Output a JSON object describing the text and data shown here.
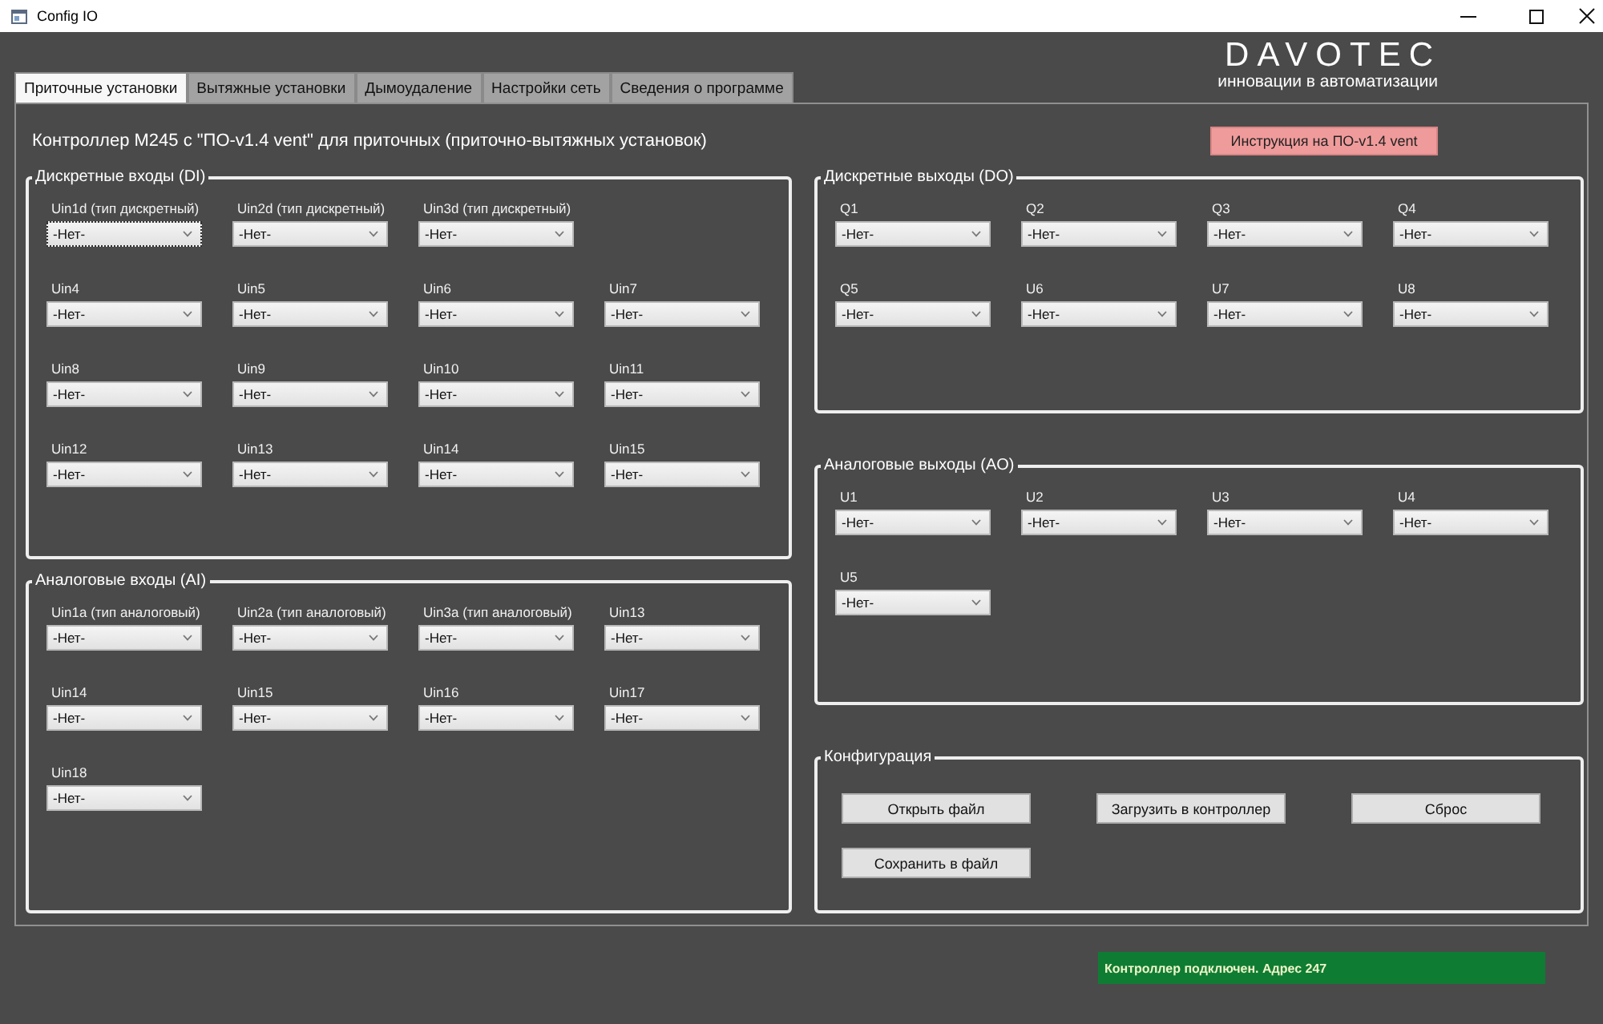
{
  "window": {
    "title": "Config IO"
  },
  "logo": {
    "brand": "DAVOTEC",
    "tagline": "инновации в автоматизации"
  },
  "tabs": [
    {
      "label": "Приточные установки",
      "selected": true
    },
    {
      "label": "Вытяжные установки",
      "selected": false
    },
    {
      "label": "Дымоудаление",
      "selected": false
    },
    {
      "label": "Настройки сеть",
      "selected": false
    },
    {
      "label": "Сведения о программе",
      "selected": false
    }
  ],
  "header": {
    "title": "Контроллер M245 с \"ПО-v1.4 vent\" для приточных (приточно-вытяжных установок)",
    "manual_button": "Инструкция на ПО-v1.4 vent"
  },
  "left_groups": [
    {
      "kind": "selects",
      "title": "Дискретные входы (DI)",
      "rows": [
        [
          {
            "label": "Uin1d (тип дискретный)",
            "value": "-Нет-",
            "focused": true
          },
          {
            "label": "Uin2d (тип дискретный)",
            "value": "-Нет-",
            "focused": false
          },
          {
            "label": "Uin3d (тип дискретный)",
            "value": "-Нет-",
            "focused": false
          }
        ],
        [
          {
            "label": "Uin4",
            "value": "-Нет-",
            "focused": false
          },
          {
            "label": "Uin5",
            "value": "-Нет-",
            "focused": false
          },
          {
            "label": "Uin6",
            "value": "-Нет-",
            "focused": false
          },
          {
            "label": "Uin7",
            "value": "-Нет-",
            "focused": false
          }
        ],
        [
          {
            "label": "Uin8",
            "value": "-Нет-",
            "focused": false
          },
          {
            "label": "Uin9",
            "value": "-Нет-",
            "focused": false
          },
          {
            "label": "Uin10",
            "value": "-Нет-",
            "focused": false
          },
          {
            "label": "Uin11",
            "value": "-Нет-",
            "focused": false
          }
        ],
        [
          {
            "label": "Uin12",
            "value": "-Нет-",
            "focused": false
          },
          {
            "label": "Uin13",
            "value": "-Нет-",
            "focused": false
          },
          {
            "label": "Uin14",
            "value": "-Нет-",
            "focused": false
          },
          {
            "label": "Uin15",
            "value": "-Нет-",
            "focused": false
          }
        ]
      ]
    },
    {
      "kind": "selects",
      "title": "Аналоговые входы (AI)",
      "rows": [
        [
          {
            "label": "Uin1a (тип аналоговый)",
            "value": "-Нет-",
            "focused": false
          },
          {
            "label": "Uin2a (тип аналоговый)",
            "value": "-Нет-",
            "focused": false
          },
          {
            "label": "Uin3a (тип аналоговый)",
            "value": "-Нет-",
            "focused": false
          },
          {
            "label": "Uin13",
            "value": "-Нет-",
            "focused": false
          }
        ],
        [
          {
            "label": "Uin14",
            "value": "-Нет-",
            "focused": false
          },
          {
            "label": "Uin15",
            "value": "-Нет-",
            "focused": false
          },
          {
            "label": "Uin16",
            "value": "-Нет-",
            "focused": false
          },
          {
            "label": "Uin17",
            "value": "-Нет-",
            "focused": false
          }
        ],
        [
          {
            "label": "Uin18",
            "value": "-Нет-",
            "focused": false
          }
        ]
      ]
    }
  ],
  "right_groups": [
    {
      "kind": "selects",
      "title": "Дискретные выходы (DO)",
      "rows": [
        [
          {
            "label": "Q1",
            "value": "-Нет-",
            "focused": false
          },
          {
            "label": "Q2",
            "value": "-Нет-",
            "focused": false
          },
          {
            "label": "Q3",
            "value": "-Нет-",
            "focused": false
          },
          {
            "label": "Q4",
            "value": "-Нет-",
            "focused": false
          }
        ],
        [
          {
            "label": "Q5",
            "value": "-Нет-",
            "focused": false
          },
          {
            "label": "U6",
            "value": "-Нет-",
            "focused": false
          },
          {
            "label": "U7",
            "value": "-Нет-",
            "focused": false
          },
          {
            "label": "U8",
            "value": "-Нет-",
            "focused": false
          }
        ]
      ]
    },
    {
      "kind": "selects",
      "title": "Аналоговые выходы (AO)",
      "rows": [
        [
          {
            "label": "U1",
            "value": "-Нет-",
            "focused": false
          },
          {
            "label": "U2",
            "value": "-Нет-",
            "focused": false
          },
          {
            "label": "U3",
            "value": "-Нет-",
            "focused": false
          },
          {
            "label": "U4",
            "value": "-Нет-",
            "focused": false
          }
        ],
        [
          {
            "label": "U5",
            "value": "-Нет-",
            "focused": false
          }
        ]
      ]
    },
    {
      "kind": "buttons",
      "title": "Конфигурация",
      "rows": [
        [
          "Открыть файл",
          "Загрузить в контроллер",
          "Сброс"
        ],
        [
          "Сохранить в файл"
        ]
      ]
    }
  ],
  "status_bar": {
    "text": "Контроллер подключен. Адрес 247"
  }
}
